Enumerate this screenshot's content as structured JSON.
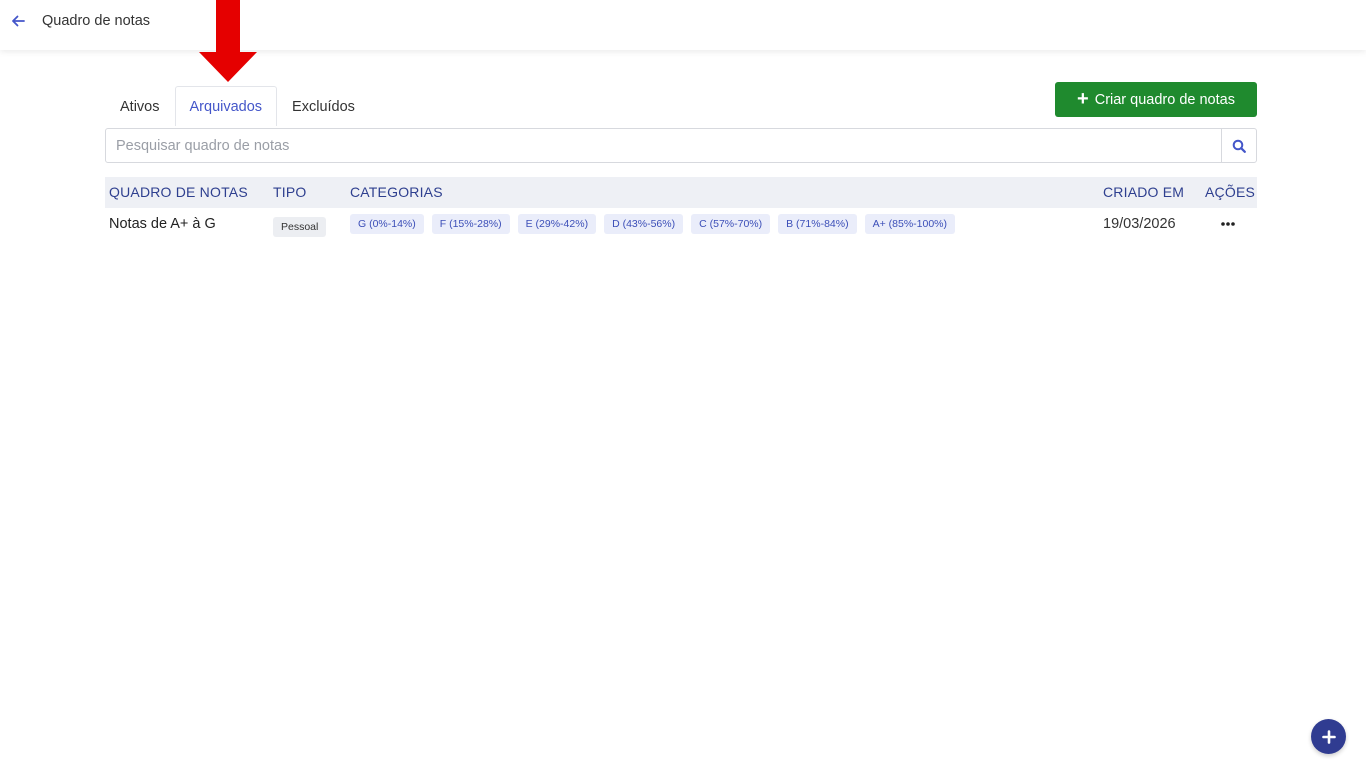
{
  "header": {
    "title": "Quadro de notas",
    "back_icon": "arrow-left-icon"
  },
  "tabs": [
    {
      "label": "Ativos",
      "active": false
    },
    {
      "label": "Arquivados",
      "active": true
    },
    {
      "label": "Excluídos",
      "active": false
    }
  ],
  "create_button": {
    "label": "Criar quadro de notas",
    "icon": "plus-icon",
    "color": "#1f8a2e"
  },
  "search": {
    "placeholder": "Pesquisar quadro de notas",
    "value": "",
    "icon": "search-icon"
  },
  "table": {
    "columns": [
      "QUADRO DE NOTAS",
      "TIPO",
      "CATEGORIAS",
      "CRIADO EM",
      "AÇÕES"
    ],
    "rows": [
      {
        "name": "Notas de A+ à G",
        "type": "Pessoal",
        "categories": [
          "G (0%-14%)",
          "F (15%-28%)",
          "E (29%-42%)",
          "D (43%-56%)",
          "C (57%-70%)",
          "B (71%-84%)",
          "A+ (85%-100%)"
        ],
        "created": "19/03/2026",
        "actions_icon": "more-horizontal-icon"
      }
    ]
  },
  "fab": {
    "icon": "plus-icon",
    "color": "#303c91"
  },
  "annotation": {
    "icon": "red-arrow-down-icon",
    "color": "#e50000"
  }
}
